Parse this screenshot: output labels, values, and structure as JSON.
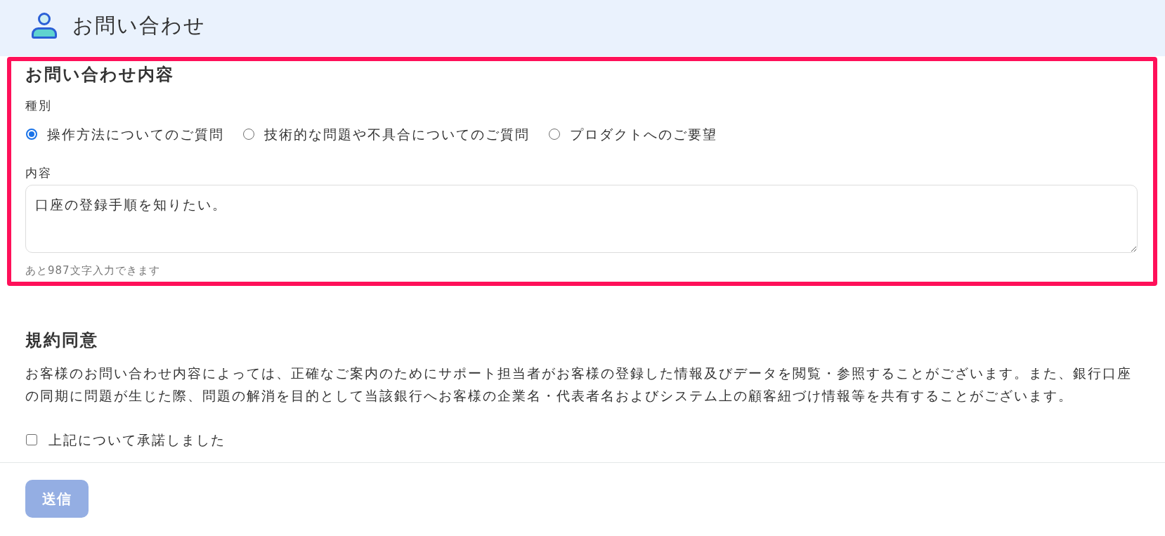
{
  "header": {
    "title": "お問い合わせ"
  },
  "inquiry": {
    "highlighted": true,
    "heading": "お問い合わせ内容",
    "type_label": "種別",
    "types": [
      {
        "label": "操作方法についてのご質問",
        "selected": true
      },
      {
        "label": "技術的な問題や不具合についてのご質問",
        "selected": false
      },
      {
        "label": "プロダクトへのご要望",
        "selected": false
      }
    ],
    "content_label": "内容",
    "content": {
      "value": "口座の登録手順を知りたい。"
    },
    "remaining": "あと987文字入力できます"
  },
  "terms": {
    "heading": "規約同意",
    "text": "お客様のお問い合わせ内容によっては、正確なご案内のためにサポート担当者がお客様の登録した情報及びデータを閲覧・参照することがございます。また、銀行口座の同期に問題が生じた際、問題の解消を目的として当該銀行へお客様の企業名・代表者名およびシステム上の顧客紐づけ情報等を共有することがございます。",
    "agreement": {
      "label": "上記について承諾しました",
      "checked": false
    }
  },
  "submit": {
    "label": "送信",
    "disabled": true
  }
}
